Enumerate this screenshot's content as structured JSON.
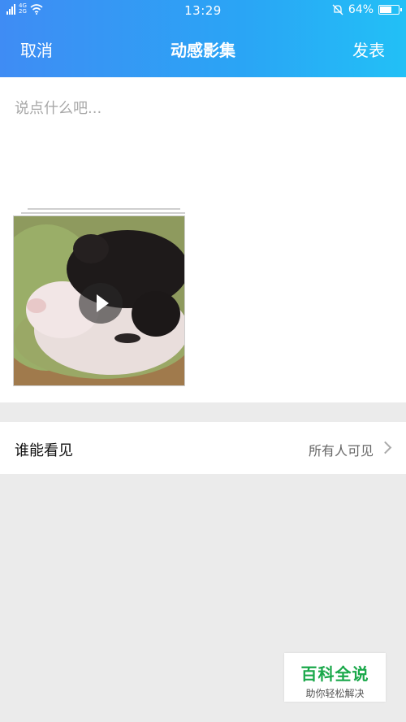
{
  "status_bar": {
    "sim1": "2G",
    "net_top": "4G",
    "net_bottom": "2G",
    "time": "13:29",
    "battery_text": "64%",
    "battery_level": 0.64
  },
  "nav": {
    "cancel": "取消",
    "title": "动感影集",
    "post": "发表"
  },
  "compose": {
    "placeholder": "说点什么吧..."
  },
  "privacy": {
    "label": "谁能看见",
    "value": "所有人可见"
  },
  "watermark": {
    "main": "百科全说",
    "sub": "助你轻松解决"
  },
  "colors": {
    "header_start": "#3f8cf4",
    "header_end": "#22c0f6",
    "watermark_green": "#1aa84a"
  }
}
